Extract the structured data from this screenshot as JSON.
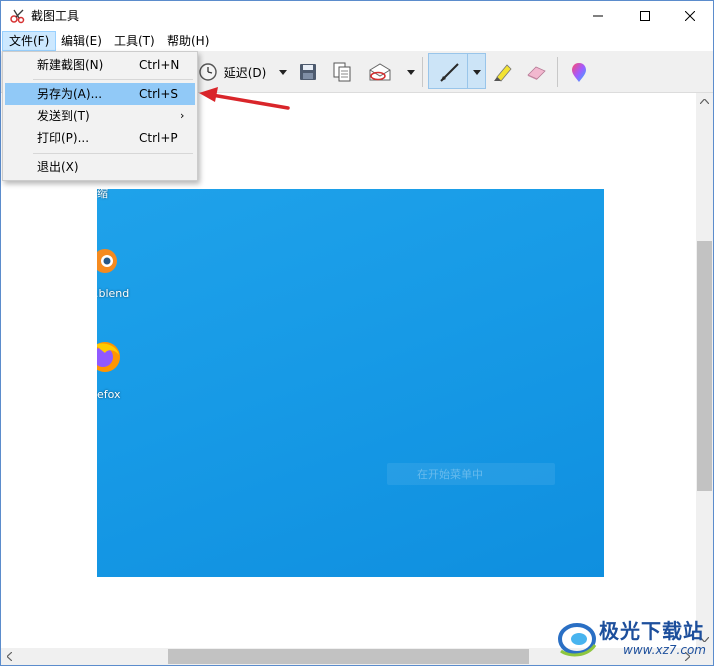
{
  "window": {
    "title": "截图工具"
  },
  "menubar": [
    {
      "label": "文件(F)",
      "active": true
    },
    {
      "label": "编辑(E)"
    },
    {
      "label": "工具(T)"
    },
    {
      "label": "帮助(H)"
    }
  ],
  "toolbar": {
    "delay_label": "延迟(D)"
  },
  "file_menu": {
    "items": [
      {
        "label": "新建截图(N)",
        "shortcut": "Ctrl+N"
      },
      {
        "label": "另存为(A)...",
        "shortcut": "Ctrl+S",
        "highlighted": true
      },
      {
        "label": "发送到(T)",
        "submenu_arrow": "›"
      },
      {
        "label": "打印(P)...",
        "shortcut": "Ctrl+P"
      },
      {
        "label": "退出(X)"
      }
    ]
  },
  "desktop_capture": {
    "icon_labels": [
      "缩",
      ".blend",
      "efox"
    ],
    "faint_text": "在开始菜单中"
  },
  "watermark": {
    "title": "极光下载站",
    "url": "www.xz7.com"
  },
  "colors": {
    "accent": "#cce8ff",
    "menu_highlight": "#91c9f7",
    "annotation_arrow": "#d9252a",
    "desktop_blue": "#179ae6"
  }
}
